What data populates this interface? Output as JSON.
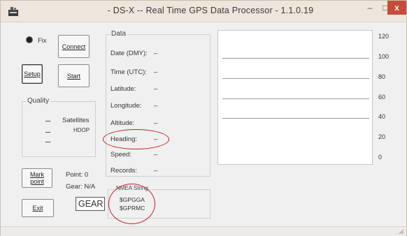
{
  "window": {
    "title": "- DS-X -- Real Time GPS Data Processor - 1.1.0.19",
    "minimize_glyph": "–",
    "maximize_glyph": "□",
    "close_glyph": "x",
    "icon": "app-icon"
  },
  "left_panel": {
    "fix_label": "Fix",
    "connect_label": "Connect",
    "setup_label": "Setup",
    "start_label": "Start",
    "quality": {
      "title": "Quality",
      "satellites_label": "Satellites",
      "hdop_label": "HDOP",
      "satellites_value": "–",
      "hdop_value": "–",
      "third_value": "–"
    },
    "mark_point_label": "Mark point",
    "point_label": "Point: 0",
    "gear_label": "Gear: N/A",
    "exit_label": "Exit",
    "gear_input_value": "GEAR"
  },
  "data_panel": {
    "title": "Data",
    "rows": [
      {
        "label": "Date (DMY):",
        "value": "–"
      },
      {
        "label": "Time (UTC):",
        "value": "–"
      },
      {
        "label": "Latitude:",
        "value": "–"
      },
      {
        "label": "Longitude:",
        "value": "–"
      },
      {
        "label": "Altitude:",
        "value": "–"
      },
      {
        "label": "Heading:",
        "value": "–"
      },
      {
        "label": "Speed:",
        "value": "–"
      },
      {
        "label": "Records:",
        "value": "–"
      }
    ]
  },
  "nmea": {
    "title": "NMEA String",
    "lines": [
      "$GPGGA",
      "$GPRMC"
    ]
  },
  "chart_data": {
    "type": "line",
    "yticks": [
      120,
      100,
      80,
      60,
      40,
      20,
      0
    ],
    "ylim": [
      0,
      120
    ],
    "gridlines": [
      100,
      80,
      60,
      40
    ],
    "series": []
  },
  "colors": {
    "annotation": "#c91f26",
    "close_button": "#c84a3a"
  }
}
